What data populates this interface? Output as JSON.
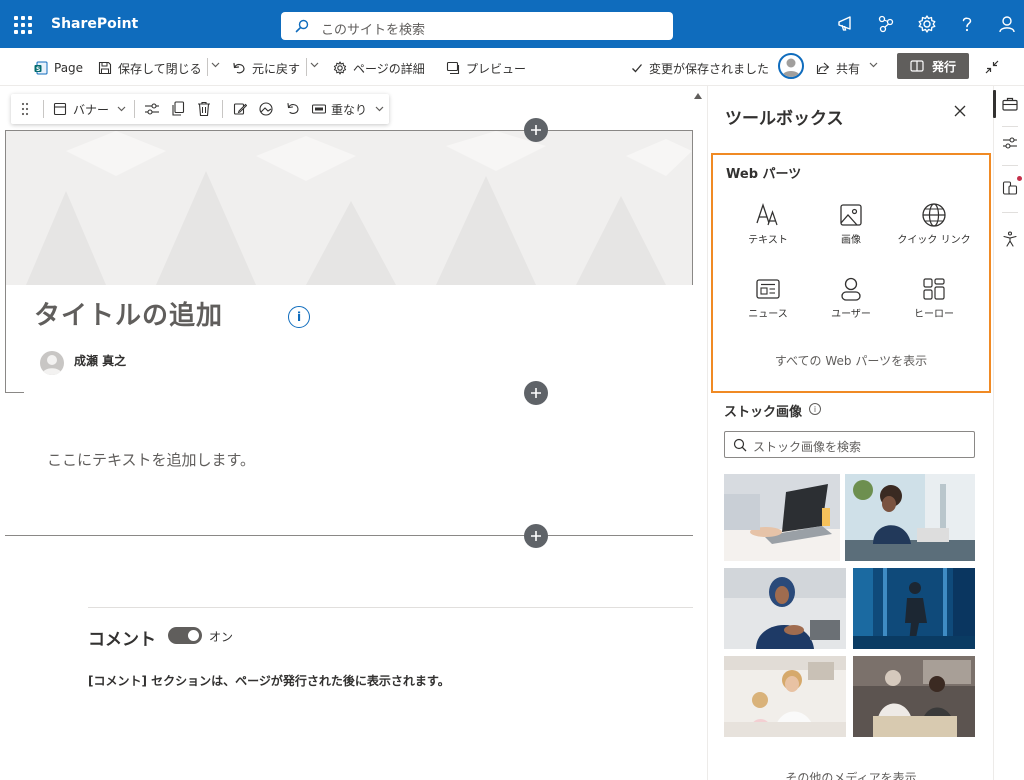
{
  "suitebar": {
    "brand": "SharePoint",
    "search_placeholder": "このサイトを検索",
    "colors": {
      "background": "#0f6cbd"
    },
    "icons": [
      "waffle-icon",
      "megaphone-icon",
      "connections-icon",
      "gear-icon",
      "help-icon",
      "account-icon"
    ]
  },
  "commandbar": {
    "page_label": "Page",
    "save_close_label": "保存して閉じる",
    "undo_label": "元に戻す",
    "details_label": "ページの詳細",
    "preview_label": "プレビュー",
    "saved_status": "変更が保存されました",
    "share_label": "共有",
    "publish_label": "発行"
  },
  "toolbar": {
    "banner_label": "バナー",
    "overlap_label": "重なり"
  },
  "page": {
    "title_placeholder": "タイトルの追加",
    "author": "成瀬 真之",
    "text_placeholder": "ここにテキストを追加します。",
    "comments_title": "コメント",
    "comments_toggle_label": "オン",
    "comments_toggle_on": true,
    "comments_note": "[コメント] セクションは、ページが発行された後に表示されます。"
  },
  "toolbox": {
    "title": "ツールボックス",
    "webparts_heading": "Web パーツ",
    "webparts": [
      {
        "label": "テキスト",
        "icon": "text-icon"
      },
      {
        "label": "画像",
        "icon": "image-icon"
      },
      {
        "label": "クイック リンク",
        "icon": "globe-icon"
      },
      {
        "label": "ニュース",
        "icon": "news-icon"
      },
      {
        "label": "ユーザー",
        "icon": "person-icon"
      },
      {
        "label": "ヒーロー",
        "icon": "hero-icon"
      }
    ],
    "show_all_label": "すべての Web パーツを表示",
    "stock_heading": "ストック画像",
    "stock_search_placeholder": "ストック画像を検索",
    "more_media_label": "その他のメディアを表示",
    "highlight_color": "#f08a24"
  }
}
